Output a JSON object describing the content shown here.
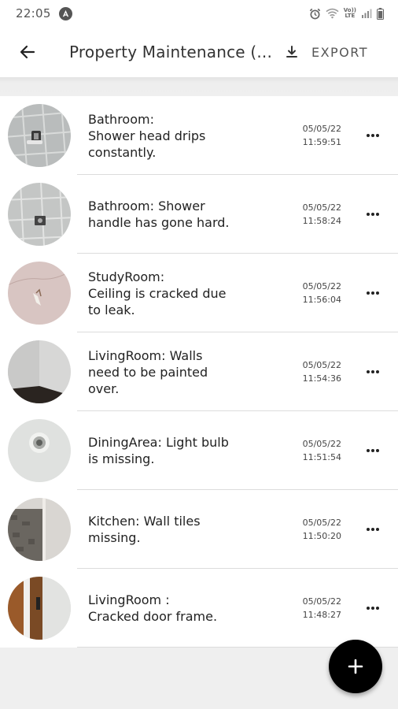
{
  "status_bar": {
    "time": "22:05",
    "volte_top": "Vo))",
    "volte_bottom": "LTE"
  },
  "app_bar": {
    "title": "Property Maintenance (...",
    "export_label": "EXPORT"
  },
  "issues": [
    {
      "text": "Bathroom:\nShower head drips constantly.",
      "date": "05/05/22",
      "time": "11:59:51",
      "thumb": "shower-head-tiles"
    },
    {
      "text": "Bathroom: Shower handle has gone hard.",
      "date": "05/05/22",
      "time": "11:58:24",
      "thumb": "shower-handle-tiles"
    },
    {
      "text": "StudyRoom:\nCeiling is cracked due to leak.",
      "date": "05/05/22",
      "time": "11:56:04",
      "thumb": "cracked-ceiling"
    },
    {
      "text": "LivingRoom: Walls need to be painted over.",
      "date": "05/05/22",
      "time": "11:54:36",
      "thumb": "wall-corner"
    },
    {
      "text": "DiningArea: Light bulb is missing.",
      "date": "05/05/22",
      "time": "11:51:54",
      "thumb": "empty-light-socket"
    },
    {
      "text": "Kitchen: Wall tiles missing.",
      "date": "05/05/22",
      "time": "11:50:20",
      "thumb": "missing-tiles"
    },
    {
      "text": "LivingRoom :\nCracked door frame.",
      "date": "05/05/22",
      "time": "11:48:27",
      "thumb": "door-frame"
    }
  ],
  "colors": {
    "accent": "#000000",
    "divider": "#dcdcdc",
    "background_band": "#efefef"
  },
  "icons": {
    "back": "arrow-left-icon",
    "export": "download-icon",
    "more": "more-horizontal-icon",
    "fab": "plus-icon"
  }
}
